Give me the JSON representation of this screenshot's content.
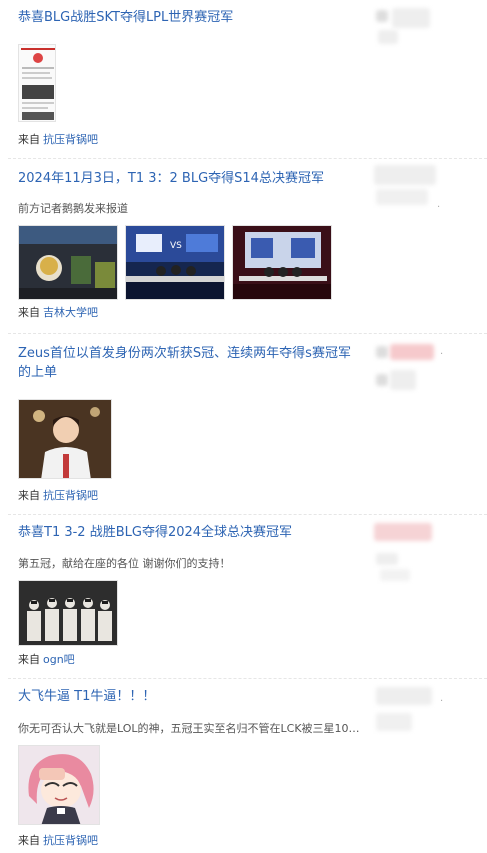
{
  "from_prefix": "来自",
  "posts": [
    {
      "title": "恭喜BLG战胜SKT夺得LPL世界赛冠军",
      "excerpt": "",
      "forum": "抗压背锅吧"
    },
    {
      "title": "2024年11月3日，T1 3：2 BLG夺得S14总决赛冠军",
      "excerpt": "前方记者鹅鹅发来报道",
      "forum": "吉林大学吧"
    },
    {
      "title": "Zeus首位以首发身份两次斩获S冠、连续两年夺得s赛冠军的上单",
      "excerpt": "",
      "forum": "抗压背锅吧"
    },
    {
      "title": "恭喜T1 3-2 战胜BLG夺得2024全球总决赛冠军",
      "excerpt": "第五冠，献给在座的各位 谢谢你们的支持！",
      "forum": "ogn吧"
    },
    {
      "title": "大飞牛逼 T1牛逼！！！",
      "excerpt": "你无可否认大飞就是LOL的神，五冠王实至名归不管在LCK被三星10擒...",
      "forum": "抗压背锅吧"
    }
  ],
  "colors": {
    "link": "#2d64b3",
    "text": "#333333",
    "divider": "#e6e6e6"
  }
}
